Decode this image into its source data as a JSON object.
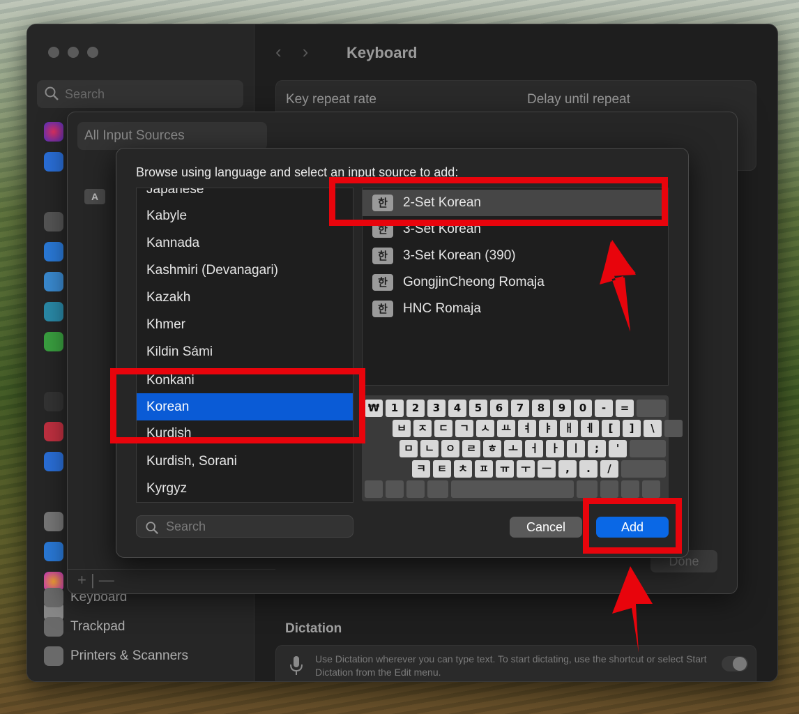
{
  "window": {
    "title": "Keyboard",
    "sidebar_search_placeholder": "Search",
    "sidebar_items": [
      {
        "label": "Keyboard"
      },
      {
        "label": "Trackpad"
      },
      {
        "label": "Printers & Scanners"
      }
    ],
    "main": {
      "key_repeat_rate": "Key repeat rate",
      "delay_until_repeat": "Delay until repeat",
      "dictation_title": "Dictation",
      "dictation_desc": "Use Dictation wherever you can type text. To start dictating, use the shortcut or select Start Dictation from the Edit menu."
    }
  },
  "input_sources_sheet": {
    "all_sources_label": "All Input Sources",
    "a_badge": "A",
    "done_label": "Done",
    "add_remove": "+  |  —"
  },
  "dialog": {
    "header": "Browse using language and select an input source to add:",
    "languages": [
      {
        "label": "Japanese"
      },
      {
        "label": "Kabyle"
      },
      {
        "label": "Kannada"
      },
      {
        "label": "Kashmiri (Devanagari)"
      },
      {
        "label": "Kazakh"
      },
      {
        "label": "Khmer"
      },
      {
        "label": "Kildin Sámi"
      },
      {
        "label": "Konkani"
      },
      {
        "label": "Korean"
      },
      {
        "label": "Kurdish"
      },
      {
        "label": "Kurdish, Sorani"
      },
      {
        "label": "Kyrgyz"
      }
    ],
    "selected_language": "Korean",
    "sources": [
      {
        "badge": "한",
        "label": "2-Set Korean"
      },
      {
        "badge": "한",
        "label": "3-Set Korean"
      },
      {
        "badge": "한",
        "label": "3-Set Korean (390)"
      },
      {
        "badge": "한",
        "label": "GongjinCheong Romaja"
      },
      {
        "badge": "한",
        "label": "HNC Romaja"
      }
    ],
    "selected_source": "2-Set Korean",
    "keyboard_rows": [
      [
        "₩",
        "1",
        "2",
        "3",
        "4",
        "5",
        "6",
        "7",
        "8",
        "9",
        "0",
        "-",
        "="
      ],
      [
        "ㅂ",
        "ㅈ",
        "ㄷ",
        "ㄱ",
        "ㅅ",
        "ㅛ",
        "ㅕ",
        "ㅑ",
        "ㅐ",
        "ㅔ",
        "[",
        "]",
        "\\"
      ],
      [
        "ㅁ",
        "ㄴ",
        "ㅇ",
        "ㄹ",
        "ㅎ",
        "ㅗ",
        "ㅓ",
        "ㅏ",
        "ㅣ",
        ";",
        "'"
      ],
      [
        "ㅋ",
        "ㅌ",
        "ㅊ",
        "ㅍ",
        "ㅠ",
        "ㅜ",
        "ㅡ",
        ",",
        ".",
        "/"
      ]
    ],
    "search_placeholder": "Search",
    "cancel_label": "Cancel",
    "add_label": "Add"
  },
  "colors": {
    "highlight_red": "#e8040c",
    "selection_blue": "#0a5bd6",
    "accent_button": "#0a68e6"
  }
}
